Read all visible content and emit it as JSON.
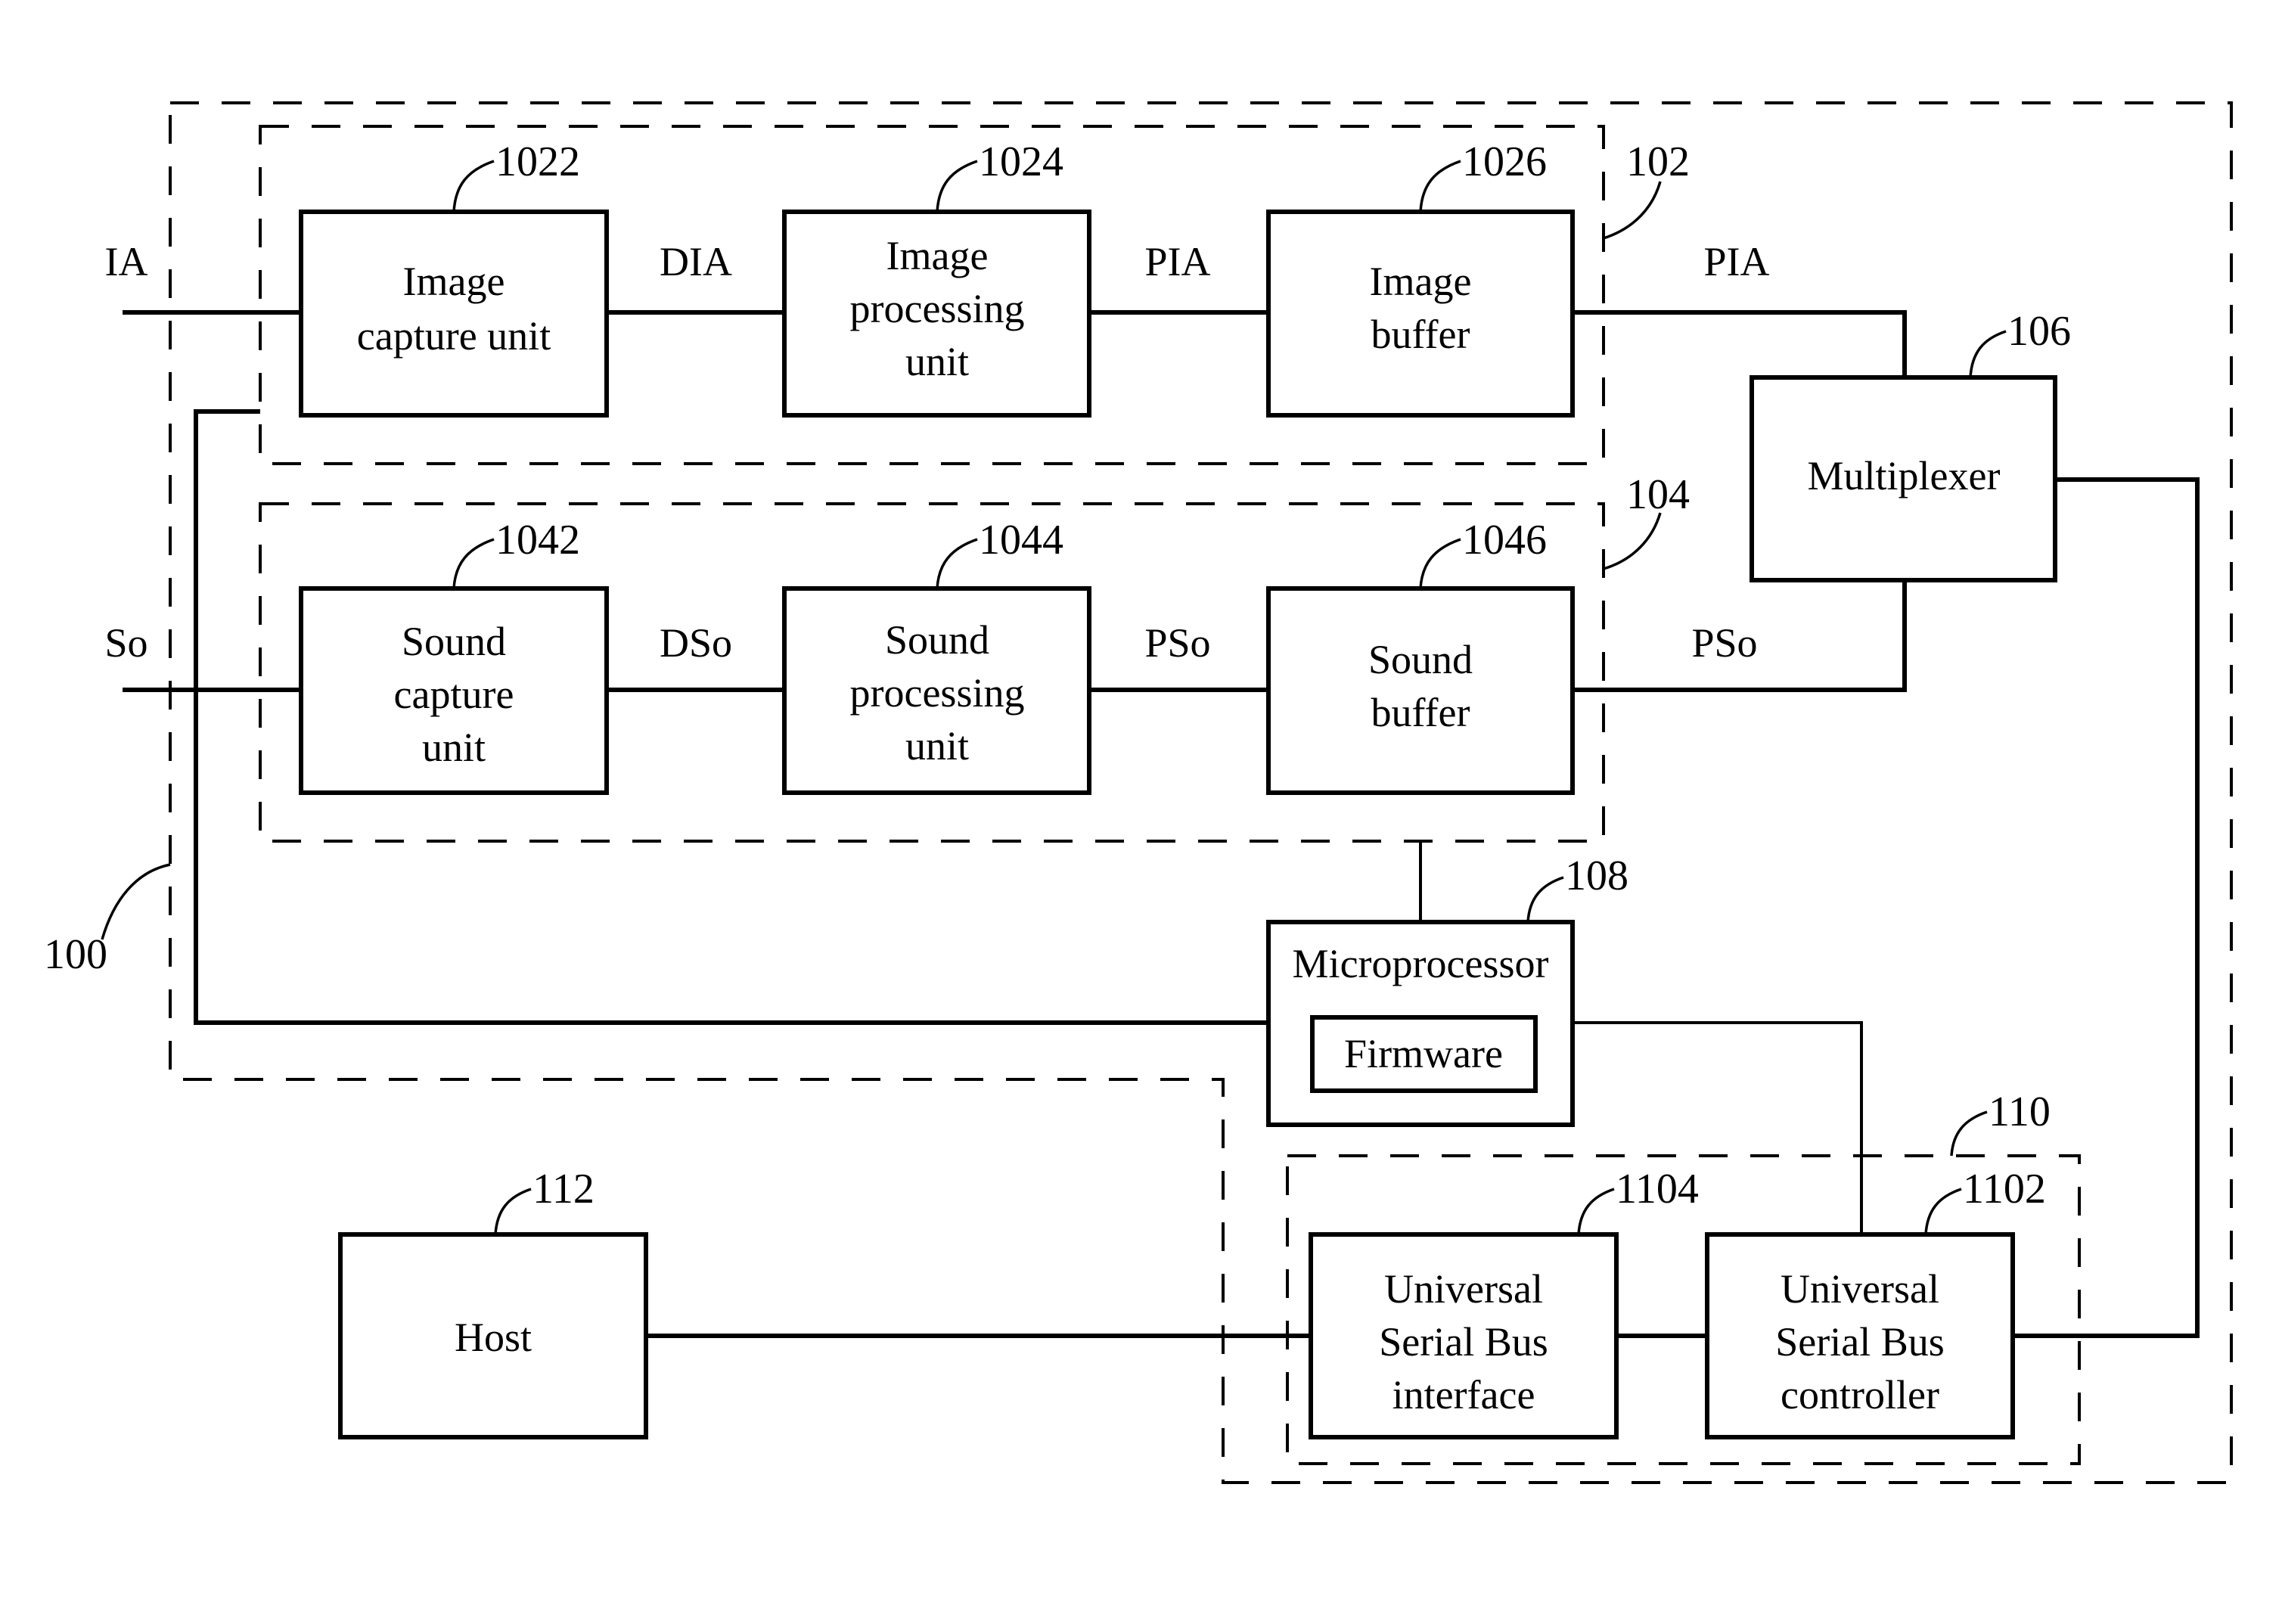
{
  "diagram": {
    "groups": {
      "g100": {
        "ref": "100"
      },
      "g102": {
        "ref": "102"
      },
      "g104": {
        "ref": "104"
      },
      "g110": {
        "ref": "110"
      }
    },
    "blocks": {
      "image_capture": {
        "ref": "1022",
        "lines": [
          "Image",
          "capture unit"
        ]
      },
      "image_processing": {
        "ref": "1024",
        "lines": [
          "Image",
          "processing",
          "unit"
        ]
      },
      "image_buffer": {
        "ref": "1026",
        "lines": [
          "Image",
          "buffer"
        ]
      },
      "sound_capture": {
        "ref": "1042",
        "lines": [
          "Sound",
          "capture",
          "unit"
        ]
      },
      "sound_processing": {
        "ref": "1044",
        "lines": [
          "Sound",
          "processing",
          "unit"
        ]
      },
      "sound_buffer": {
        "ref": "1046",
        "lines": [
          "Sound",
          "buffer"
        ]
      },
      "multiplexer": {
        "ref": "106",
        "lines": [
          "Multiplexer"
        ]
      },
      "microprocessor": {
        "ref": "108",
        "lines": [
          "Microprocessor"
        ]
      },
      "firmware": {
        "lines": [
          "Firmware"
        ]
      },
      "usb_interface": {
        "ref": "1104",
        "lines": [
          "Universal",
          "Serial Bus",
          "interface"
        ]
      },
      "usb_controller": {
        "ref": "1102",
        "lines": [
          "Universal",
          "Serial Bus",
          "controller"
        ]
      },
      "host": {
        "ref": "112",
        "lines": [
          "Host"
        ]
      }
    },
    "signals": {
      "ia": "IA",
      "dia": "DIA",
      "pia_1": "PIA",
      "pia_2": "PIA",
      "so": "So",
      "dso": "DSo",
      "pso_1": "PSo",
      "pso_2": "PSo"
    }
  }
}
